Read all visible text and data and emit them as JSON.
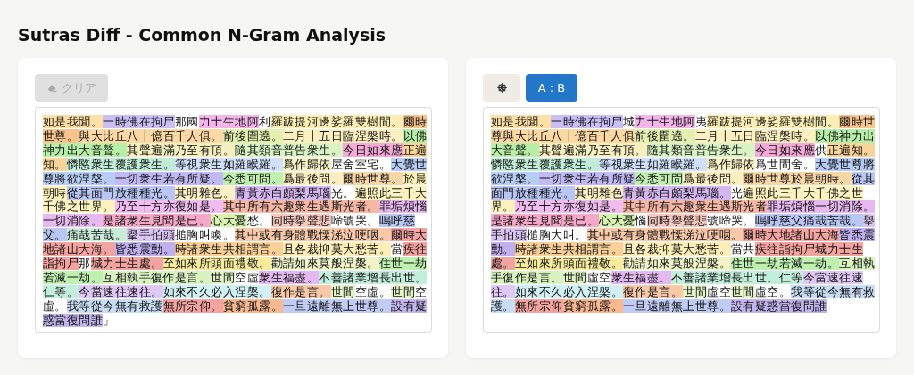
{
  "title": "Sutras Diff - Common N-Gram Analysis",
  "left_panel": {
    "clear_button": {
      "label": "クリア",
      "disabled": true
    },
    "segments": [
      {
        "text": "如是我聞。",
        "color": "#fde0a6"
      },
      {
        "text": "一時佛在拘尸",
        "color": "#c9bff4"
      },
      {
        "text": "那國"
      },
      {
        "text": "力士生地阿",
        "color": "#f4b5ea"
      },
      {
        "text": "利"
      },
      {
        "text": "羅跋提河邊娑羅雙樹間。",
        "color": "#fbeeb4"
      },
      {
        "text": "爾時",
        "color": "#f8c48e"
      },
      {
        "text": "世尊。",
        "color": "#f8c48e"
      },
      {
        "text": "與大比丘八十億百千人俱。",
        "color": "#fcd9a4"
      },
      {
        "text": "前後圍遶。",
        "color": "#e4efb0"
      },
      {
        "text": "二月十五日臨涅槃時。",
        "color": "#fcefc0"
      },
      {
        "text": "以佛",
        "color": "#b8efa8"
      },
      {
        "text": "神力出大音聲。",
        "color": "#b8efa8"
      },
      {
        "text": "其聲遍滿乃至有頂。",
        "color": "#f6f0c0"
      },
      {
        "text": "隨其類音普告衆生。",
        "color": "#d9f3c4"
      },
      {
        "text": "今日如來應",
        "color": "#f5a9d8"
      },
      {
        "text": "正遍",
        "color": "#f8d49a"
      },
      {
        "text": "知。",
        "color": "#f8d49a"
      },
      {
        "text": "憐愍衆生覆護衆生。",
        "color": "#c0ecd8"
      },
      {
        "text": "等視衆生如羅睺羅。",
        "color": "#cfe0f8"
      },
      {
        "text": "爲作歸依",
        "color": "#f7f0c4"
      },
      {
        "text": "屋舍室宅。"
      },
      {
        "text": "大覺世",
        "color": "#b8cdf5"
      },
      {
        "text": "尊將欲涅槃。",
        "color": "#b8cdf5"
      },
      {
        "text": "一切衆生若有所疑。",
        "color": "#c1b9f3"
      },
      {
        "text": "今悉可問。",
        "color": "#c0f0b0"
      },
      {
        "text": "爲最後問。",
        "color": "#fbeec0"
      },
      {
        "text": "爾時世尊。",
        "color": "#f7d7a6"
      },
      {
        "text": "於晨",
        "color": "#fcf2b8"
      },
      {
        "text": "朝時",
        "color": "#fcf2b8"
      },
      {
        "text": "從其面門放種種光。",
        "color": "#b9c6f4"
      },
      {
        "text": "其明雜色。",
        "color": "#fbf0c6"
      },
      {
        "text": "青黃赤白頗梨馬瑙",
        "color": "#d4b6f0"
      },
      {
        "text": "光。"
      },
      {
        "text": "遍照此三千大",
        "color": "#fcf2c0"
      },
      {
        "text": "千佛之世界。",
        "color": "#fcf2c0"
      },
      {
        "text": "乃至十方亦復如是。",
        "color": "#f1bdf0"
      },
      {
        "text": "其中所有六趣衆生遇斯光者。",
        "color": "#f6b7a6"
      },
      {
        "text": "罪垢煩惱",
        "color": "#e8b8f0"
      },
      {
        "text": "一切消除。",
        "color": "#e8b8f0"
      },
      {
        "text": "是諸衆生見聞是已。",
        "color": "#f5a8c8"
      },
      {
        "text": "心大憂",
        "color": "#d8f2b0"
      },
      {
        "text": "愁。"
      },
      {
        "text": "同時擧聲悲",
        "color": "#f6c9c0"
      },
      {
        "text": "啼號哭。"
      },
      {
        "text": "嗚呼慈",
        "color": "#b8c6f4"
      },
      {
        "text": "父。",
        "color": "#b8c6f4"
      },
      {
        "text": "痛哉苦哉。",
        "color": "#c8ecd8"
      },
      {
        "text": "擧手拍頭",
        "color": "#d9c4f2"
      },
      {
        "text": "搥胸叫喚。"
      },
      {
        "text": "其中或有身體戰慄涕泣哽咽。",
        "color": "#f8c8a8"
      },
      {
        "text": "爾時大",
        "color": "#f4a4a0"
      },
      {
        "text": "地諸山大海。",
        "color": "#f4a4a0"
      },
      {
        "text": "皆悉震動。",
        "color": "#c0b0f0"
      },
      {
        "text": "時諸衆生共相謂言。",
        "color": "#f8d098"
      },
      {
        "text": "且各裁抑莫大愁苦。",
        "color": "#fbeeb8"
      },
      {
        "text": "當"
      },
      {
        "text": "疾往",
        "color": "#f4a4a0"
      },
      {
        "text": "詣拘尸",
        "color": "#f4a4a0"
      },
      {
        "text": "那"
      },
      {
        "text": "城力士生處。",
        "color": "#f4a4a0"
      },
      {
        "text": "至如來所頭面禮敬。",
        "color": "#f8ec9c"
      },
      {
        "text": "勸請如來莫般涅槃。",
        "color": "#f0f4c8"
      },
      {
        "text": "住世一劫",
        "color": "#bff0b0"
      },
      {
        "text": "若滅一劫。",
        "color": "#bff0b0"
      },
      {
        "text": "互相執手復作是言。",
        "color": "#d8f2c0"
      },
      {
        "text": "世間",
        "color": "#e0f4c8"
      },
      {
        "text": "空虛"
      },
      {
        "text": "衆生福盡。",
        "color": "#e4b8f0"
      },
      {
        "text": "不善諸業增長出世。",
        "color": "#c4eedc"
      },
      {
        "text": "仁等。",
        "color": "#c4eedc"
      },
      {
        "text": "今當速往速往。",
        "color": "#e0c8f4"
      },
      {
        "text": "如來不久必入涅槃。",
        "color": "#d0f0f4"
      },
      {
        "text": "復作是言。",
        "color": "#f8c8a8"
      },
      {
        "text": "世間",
        "color": "#e4f4c8"
      },
      {
        "text": "空虛。"
      },
      {
        "text": "世間",
        "color": "#e4f4c8"
      },
      {
        "text": "空"
      },
      {
        "text": "虛。"
      },
      {
        "text": "我等從今無有救護",
        "color": "#c8dcf4"
      },
      {
        "text": "無所宗仰。",
        "color": "#f4a4a0"
      },
      {
        "text": "貧窮孤露。",
        "color": "#f8b890"
      },
      {
        "text": "一旦遠離無上世尊。",
        "color": "#c0ccf4"
      },
      {
        "text": "設有疑",
        "color": "#c4b4ec"
      },
      {
        "text": "惑當復問誰",
        "color": "#c4b4ec"
      },
      {
        "text": "」"
      }
    ]
  },
  "right_panel": {
    "mode_button": {
      "label": "A : B",
      "selected": true
    },
    "segments": [
      {
        "text": "如是我聞。",
        "color": "#fde0a6"
      },
      {
        "text": "一時佛在拘尸",
        "color": "#c9bff4"
      },
      {
        "text": "城"
      },
      {
        "text": "力士生地阿",
        "color": "#f4b5ea"
      },
      {
        "text": "夷"
      },
      {
        "text": "羅跋提河邊娑羅雙樹間。",
        "color": "#fbeeb4"
      },
      {
        "text": "爾時世",
        "color": "#f8c48e"
      },
      {
        "text": "尊與大比丘八十億百千人俱",
        "color": "#fcd9a4"
      },
      {
        "text": "前後圍遶。",
        "color": "#e4efb0"
      },
      {
        "text": "二月十五日臨涅槃時。",
        "color": "#fcefc0"
      },
      {
        "text": "以佛神力出",
        "color": "#b8efa8"
      },
      {
        "text": "大音聲。",
        "color": "#b8efa8"
      },
      {
        "text": "其聲遍滿乃至有頂。",
        "color": "#f6f0c0"
      },
      {
        "text": "隨其類音普告衆生。",
        "color": "#d9f3c4"
      },
      {
        "text": "今日如來應",
        "color": "#f5a9d8"
      },
      {
        "text": "供"
      },
      {
        "text": "正遍知。",
        "color": "#f8d49a"
      },
      {
        "text": "憐愍衆生覆護衆生。",
        "color": "#c0ecd8"
      },
      {
        "text": "等視衆生如羅睺羅。",
        "color": "#cfe0f8"
      },
      {
        "text": "爲作歸依",
        "color": "#f7f0c4"
      },
      {
        "text": "爲世間舍。"
      },
      {
        "text": "大覺世尊將",
        "color": "#b8cdf5"
      },
      {
        "text": "欲涅槃。",
        "color": "#b8cdf5"
      },
      {
        "text": "一切衆生若有所疑",
        "color": "#c1b9f3"
      },
      {
        "text": "今悉可問",
        "color": "#c0f0b0"
      },
      {
        "text": "爲最後問。",
        "color": "#fbeec0"
      },
      {
        "text": "爾時世尊於晨朝時。",
        "color": "#f7d7a6"
      },
      {
        "text": "從其",
        "color": "#b9c6f4"
      },
      {
        "text": "面門放種種光。",
        "color": "#b9c6f4"
      },
      {
        "text": "其明雜色",
        "color": "#fbf0c6"
      },
      {
        "text": "青黃赤白頗梨馬瑙。",
        "color": "#d4b6f0"
      },
      {
        "text": "光"
      },
      {
        "text": "遍照此三千大千佛之世",
        "color": "#fcf2c0"
      },
      {
        "text": "界。",
        "color": "#fcf2c0"
      },
      {
        "text": "乃至十方亦復如是。",
        "color": "#f1bdf0"
      },
      {
        "text": "其中所有六趣衆生遇斯光者",
        "color": "#f6b7a6"
      },
      {
        "text": "罪垢煩惱一切消除。",
        "color": "#e8b8f0"
      },
      {
        "text": "是諸衆生見聞是已。",
        "color": "#f5a8c8"
      },
      {
        "text": "心大憂",
        "color": "#d8f2b0"
      },
      {
        "text": "惱"
      },
      {
        "text": "同時擧聲悲",
        "color": "#f6c9c0"
      },
      {
        "text": "號啼哭。"
      },
      {
        "text": "嗚呼慈父痛哉苦哉。",
        "color": "#b8c6f4"
      },
      {
        "text": "擧",
        "color": "#d9c4f2"
      },
      {
        "text": "手拍頭",
        "color": "#d9c4f2"
      },
      {
        "text": "槌胸大叫。"
      },
      {
        "text": "其中或有身體戰慄涕泣哽咽。",
        "color": "#f8c8a8"
      },
      {
        "text": "爾時大地諸山大海",
        "color": "#f4a4a0"
      },
      {
        "text": "皆悉震",
        "color": "#c0b0f0"
      },
      {
        "text": "動。",
        "color": "#c0b0f0"
      },
      {
        "text": "時諸衆生共相謂言。",
        "color": "#f8d098"
      },
      {
        "text": "且各裁抑莫大愁苦。",
        "color": "#fbeeb8"
      },
      {
        "text": "當共"
      },
      {
        "text": "疾往詣拘尸城力士生",
        "color": "#f4a4a0"
      },
      {
        "text": "處。",
        "color": "#f4a4a0"
      },
      {
        "text": "至如來所頭面禮敬。",
        "color": "#f8ec9c"
      },
      {
        "text": "勸請如來莫般涅槃。",
        "color": "#f0f4c8"
      },
      {
        "text": "住世一劫若滅一劫。",
        "color": "#bff0b0"
      },
      {
        "text": "互相執",
        "color": "#d8f2c0"
      },
      {
        "text": "手復作是言。",
        "color": "#d8f2c0"
      },
      {
        "text": "世間",
        "color": "#e0f4c8"
      },
      {
        "text": "虛空"
      },
      {
        "text": "衆生福盡。",
        "color": "#e4b8f0"
      },
      {
        "text": "不善諸業增長出世。",
        "color": "#c4eedc"
      },
      {
        "text": "仁等",
        "color": "#c4eedc"
      },
      {
        "text": "今當速往速",
        "color": "#e0c8f4"
      },
      {
        "text": "往。",
        "color": "#e0c8f4"
      },
      {
        "text": "如來不久必入涅槃。",
        "color": "#d0f0f4"
      },
      {
        "text": "復作是言。",
        "color": "#f8c8a8"
      },
      {
        "text": "世間",
        "color": "#e4f4c8"
      },
      {
        "text": "虛空"
      },
      {
        "text": "世間",
        "color": "#e4f4c8"
      },
      {
        "text": "虛空。"
      },
      {
        "text": "我等從今無有救",
        "color": "#c8dcf4"
      },
      {
        "text": "護。",
        "color": "#c8dcf4"
      },
      {
        "text": "無所宗仰",
        "color": "#f4a4a0"
      },
      {
        "text": "貧窮孤露。",
        "color": "#f8b890"
      },
      {
        "text": "一旦遠離無上世尊。",
        "color": "#c0ccf4"
      },
      {
        "text": "設有疑惑當復問誰",
        "color": "#c4b4ec"
      }
    ]
  }
}
